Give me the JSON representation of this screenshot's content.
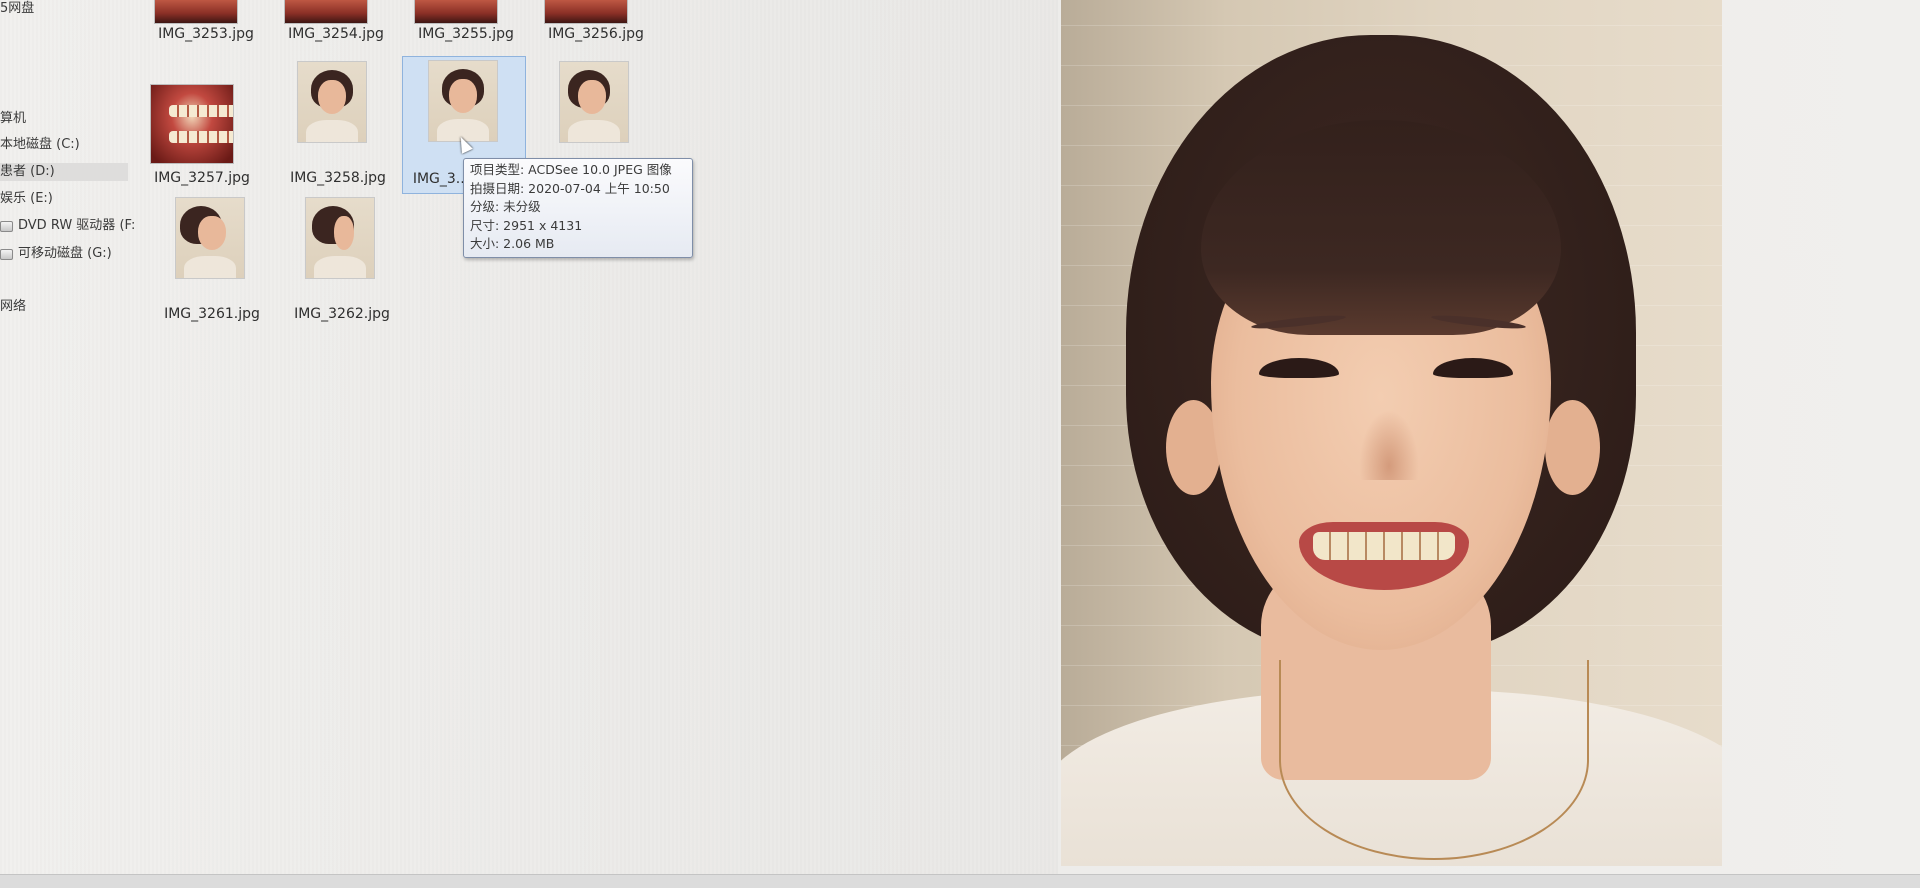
{
  "navigation": {
    "items": [
      {
        "label": "5网盘"
      },
      {
        "label": "算机"
      },
      {
        "label": "本地磁盘 (C:)"
      },
      {
        "label": "患者 (D:)"
      },
      {
        "label": "娱乐 (E:)"
      },
      {
        "label": "DVD RW 驱动器 (F:"
      },
      {
        "label": "可移动磁盘 (G:)"
      },
      {
        "label": "网络"
      }
    ]
  },
  "files": {
    "row1": [
      {
        "name": "IMG_3253.jpg"
      },
      {
        "name": "IMG_3254.jpg"
      },
      {
        "name": "IMG_3255.jpg"
      },
      {
        "name": "IMG_3256.jpg"
      }
    ],
    "row2": [
      {
        "name": "IMG_3257.jpg"
      },
      {
        "name": "IMG_3258.jpg"
      },
      {
        "name": "IMG_3..."
      },
      {
        "name": ""
      }
    ],
    "row3": [
      {
        "name": "IMG_3261.jpg"
      },
      {
        "name": "IMG_3262.jpg"
      }
    ]
  },
  "tooltip": {
    "type": "项目类型: ACDSee 10.0 JPEG 图像",
    "date": "拍摄日期: 2020-07-04 上午 10:50",
    "rating": "分级: 未分级",
    "dimensions": "尺寸: 2951 x 4131",
    "size": "大小: 2.06 MB"
  },
  "colors": {
    "selection": "#cfe0f3",
    "tooltip_border": "#7f8ea8",
    "background": "#ecebe8"
  }
}
